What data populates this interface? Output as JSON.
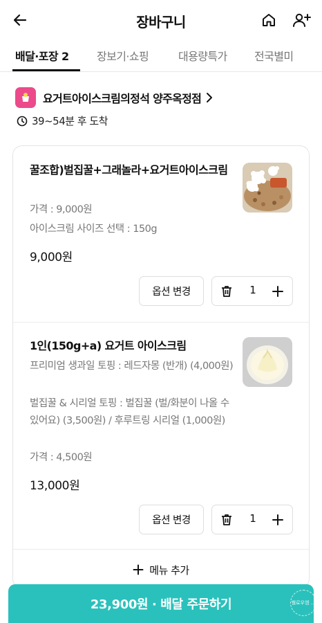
{
  "header": {
    "title": "장바구니",
    "back_icon": "arrow-left-icon",
    "home_icon": "home-icon",
    "add_user_icon": "user-plus-icon"
  },
  "tabs": [
    {
      "label": "배달·포장",
      "count": "2",
      "active": true
    },
    {
      "label": "장보기·쇼핑",
      "active": false
    },
    {
      "label": "대용량특가",
      "active": false
    },
    {
      "label": "전국별미",
      "active": false
    }
  ],
  "store": {
    "name": "요거트아이스크림의정석 양주옥정점",
    "chevron": "chevron-right-icon",
    "logo_color": "#ec4a8b",
    "eta": "39~54분 후 도착"
  },
  "items": [
    {
      "name": "꿀조합)벌집꿀+그래놀라+요거트아이스크림",
      "options": [
        "가격 : 9,000원",
        "아이스크림 사이즈 선택 : 150g"
      ],
      "price": "9,000원",
      "option_button": "옵션 변경",
      "quantity": "1"
    },
    {
      "name": "1인(150g+a) 요거트 아이스크림",
      "options": [
        "프리미엄 생과일 토핑 : 레드자몽 (반개) (4,000원)",
        "벌집꿀 & 시리얼 토핑 : 벌집꿀 (벌/화분이 나올 수 있어요) (3,500원) / 후루트링 시리얼 (1,000원)",
        "가격 : 4,500원"
      ],
      "price": "13,000원",
      "option_button": "옵션 변경",
      "quantity": "1"
    }
  ],
  "add_menu": "메뉴 추가",
  "order_button": "23,900원 · 배달 주문하기",
  "watermark": "웰로우엠 ...",
  "colors": {
    "accent": "#2ac1bc",
    "brand": "#ec4a8b"
  }
}
